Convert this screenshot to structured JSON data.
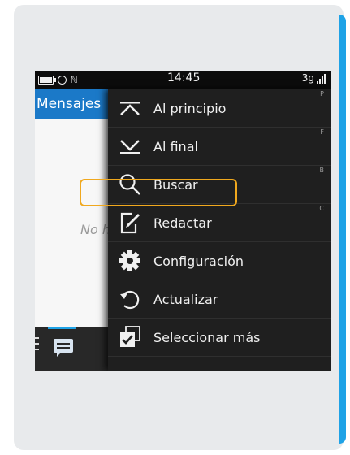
{
  "status_bar": {
    "time": "14:45",
    "network": "3g",
    "icons": [
      "battery-icon",
      "alarm-icon",
      "nfc-icon",
      "signal-icon"
    ]
  },
  "app": {
    "title": "Mensajes",
    "empty_text": "No h"
  },
  "menu": {
    "items": [
      {
        "label": "Al principio",
        "shortcut": "P",
        "icon": "top-icon"
      },
      {
        "label": "Al final",
        "shortcut": "F",
        "icon": "bottom-icon"
      },
      {
        "label": "Buscar",
        "shortcut": "B",
        "icon": "search-icon"
      },
      {
        "label": "Redactar",
        "shortcut": "C",
        "icon": "compose-icon"
      },
      {
        "label": "Configuración",
        "shortcut": "",
        "icon": "gear-icon",
        "highlighted": true
      },
      {
        "label": "Actualizar",
        "shortcut": "",
        "icon": "refresh-icon"
      },
      {
        "label": "Seleccionar más",
        "shortcut": "",
        "icon": "select-more-icon"
      }
    ]
  },
  "colors": {
    "highlight": "#f0a81e",
    "accent": "#1ea2e6",
    "header": "#1b79c8"
  }
}
